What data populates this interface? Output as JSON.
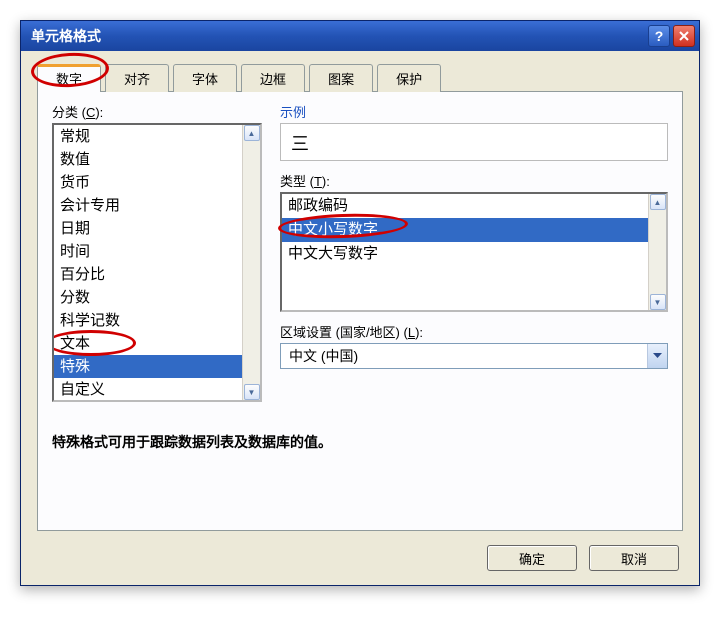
{
  "titlebar": {
    "title": "单元格格式"
  },
  "tabs": {
    "items": [
      {
        "label": "数字",
        "active": true
      },
      {
        "label": "对齐",
        "active": false
      },
      {
        "label": "字体",
        "active": false
      },
      {
        "label": "边框",
        "active": false
      },
      {
        "label": "图案",
        "active": false
      },
      {
        "label": "保护",
        "active": false
      }
    ]
  },
  "category": {
    "label": "分类 (C):",
    "items": [
      "常规",
      "数值",
      "货币",
      "会计专用",
      "日期",
      "时间",
      "百分比",
      "分数",
      "科学记数",
      "文本",
      "特殊",
      "自定义"
    ],
    "selected_index": 10
  },
  "sample": {
    "label": "示例",
    "value": "三"
  },
  "type": {
    "label": "类型 (T):",
    "items": [
      "邮政编码",
      "中文小写数字",
      "中文大写数字"
    ],
    "selected_index": 1
  },
  "locale": {
    "label": "区域设置 (国家/地区) (L):",
    "value": "中文 (中国)"
  },
  "description": "特殊格式可用于跟踪数据列表及数据库的值。",
  "buttons": {
    "ok": "确定",
    "cancel": "取消"
  }
}
